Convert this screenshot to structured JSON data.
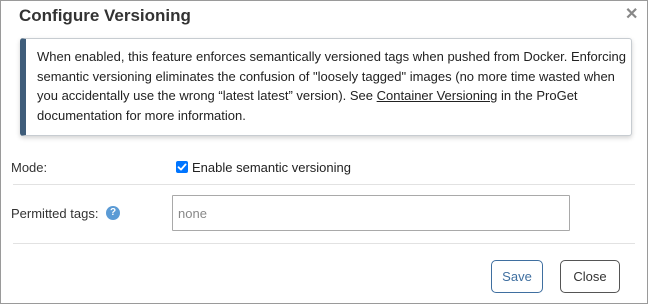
{
  "dialog": {
    "title": "Configure Versioning",
    "close_icon": "close-icon"
  },
  "info": {
    "text_before_link": "When enabled, this feature enforces semantically versioned tags when pushed from Docker. Enforcing semantic versioning eliminates the confusion of \"loosely tagged\" images (no more time wasted when you accidentally use the wrong “latest latest” version). See ",
    "link_text": "Container Versioning",
    "text_after_link": " in the ProGet documentation for more information."
  },
  "mode": {
    "label": "Mode:",
    "checkbox_label": "Enable semantic versioning",
    "checked": true
  },
  "permitted_tags": {
    "label": "Permitted tags:",
    "help_icon": "help-icon",
    "placeholder": "none",
    "value": ""
  },
  "buttons": {
    "save": "Save",
    "close": "Close"
  },
  "colors": {
    "accent": "#3f5d7a",
    "checkbox": "#0075ff",
    "help_icon": "#5b9bd5"
  }
}
